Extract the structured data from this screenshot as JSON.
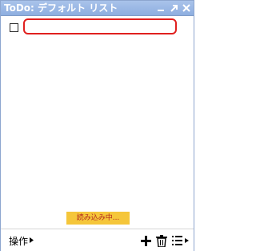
{
  "window": {
    "title": "ToDo: デフォルト リスト",
    "buttons": {
      "minimize_icon": "minimize-icon",
      "popout_icon": "popout-icon",
      "close_icon": "close-icon"
    }
  },
  "task_list": {
    "items": [
      {
        "checked": false,
        "value": ""
      }
    ]
  },
  "status": {
    "loading_text": "読み込み中..."
  },
  "footer": {
    "actions_label": "操作",
    "actions_icon": "caret-right-icon",
    "add_icon": "plus-icon",
    "delete_icon": "trash-icon",
    "list_menu_icon": "list-icon"
  },
  "colors": {
    "titlebar": "#8eaee0",
    "input_border": "#e0201f",
    "loading_bg": "#f5c63a",
    "loading_text": "#b3261e"
  }
}
